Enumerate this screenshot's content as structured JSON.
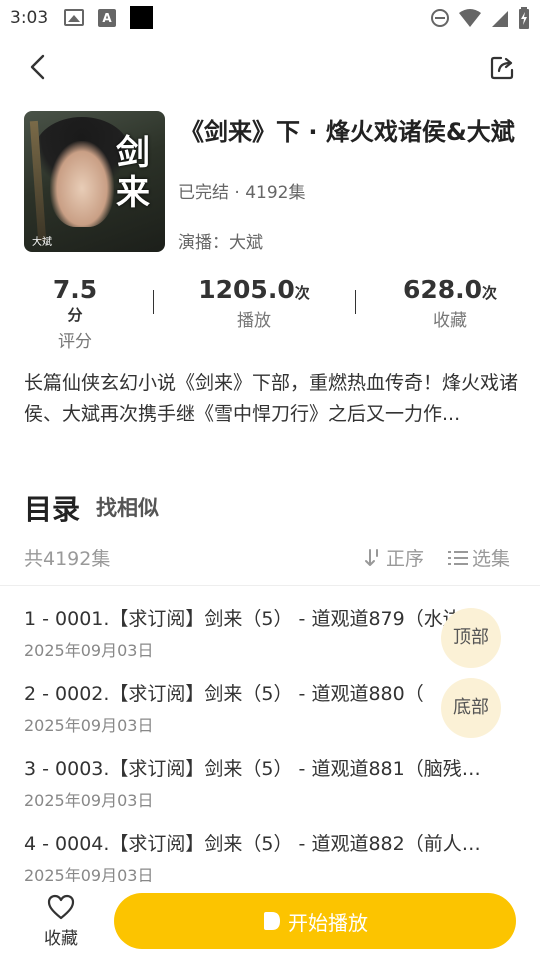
{
  "status_bar": {
    "time": "3:03",
    "a_icon_letter": "A"
  },
  "book": {
    "title": "《剑来》下 · 烽火戏诸侯&大斌",
    "status": "已完结 · 4192集",
    "narrator": "演播：大斌",
    "cover_title_art": "剑来",
    "cover_author_tag": "大斌"
  },
  "stats": [
    {
      "value": "7.5",
      "unit": "分",
      "label": "评分"
    },
    {
      "value": "1205.0",
      "unit": "次",
      "label": "播放"
    },
    {
      "value": "628.0",
      "unit": "次",
      "label": "收藏"
    }
  ],
  "description": "长篇仙侠玄幻小说《剑来》下部，重燃热血传奇！烽火戏诸侯、大斌再次携手继《雪中悍刀行》之后又一力作...",
  "catalog": {
    "title": "目录",
    "similar": "找相似",
    "total": "共4192集",
    "order": "正序",
    "select": "选集"
  },
  "episodes": [
    {
      "title": "1 - 0001.【求订阅】剑来（5） - 道观道879（水边…",
      "date": "2025年09月03日"
    },
    {
      "title": "2 - 0002.【求订阅】剑来（5） - 道观道880（ ",
      "date": "2025年09月03日"
    },
    {
      "title": "3 - 0003.【求订阅】剑来（5） - 道观道881（脑残…",
      "date": "2025年09月03日"
    },
    {
      "title": "4 - 0004.【求订阅】剑来（5） - 道观道882（前人…",
      "date": "2025年09月03日"
    }
  ],
  "floating": {
    "top": "顶部",
    "bottom": "底部"
  },
  "bottom_bar": {
    "favorite": "收藏",
    "play": "开始播放"
  },
  "colors": {
    "accent": "#fcc400",
    "float_bg": "#fbf1d6"
  }
}
